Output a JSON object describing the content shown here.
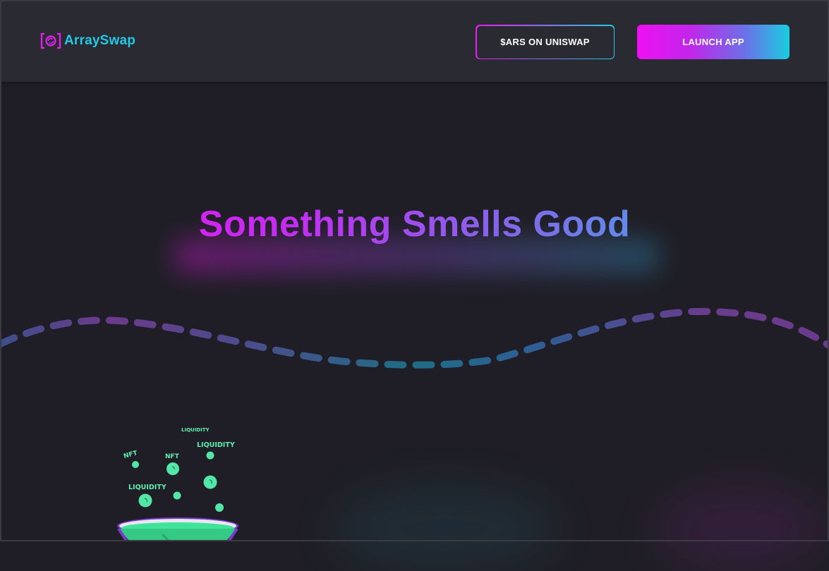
{
  "header": {
    "logo_text": "ArraySwap",
    "uniswap_button_label": "$ARS ON UNISWAP",
    "launch_button_label": "LAUNCH APP"
  },
  "hero": {
    "title": "Something Smells Good"
  },
  "illustration": {
    "labels": [
      "LIQUIDITY",
      "NFT",
      "NFT",
      "LIQUIDITY",
      "LIQUIDITY"
    ]
  },
  "colors": {
    "background": "#1f1e26",
    "header_background": "#2a2a33",
    "magenta": "#f30ef5",
    "cyan": "#21cbe3",
    "potion_green": "#5ff0b0"
  },
  "icons": {
    "logo": "array-swap-logo-icon"
  }
}
